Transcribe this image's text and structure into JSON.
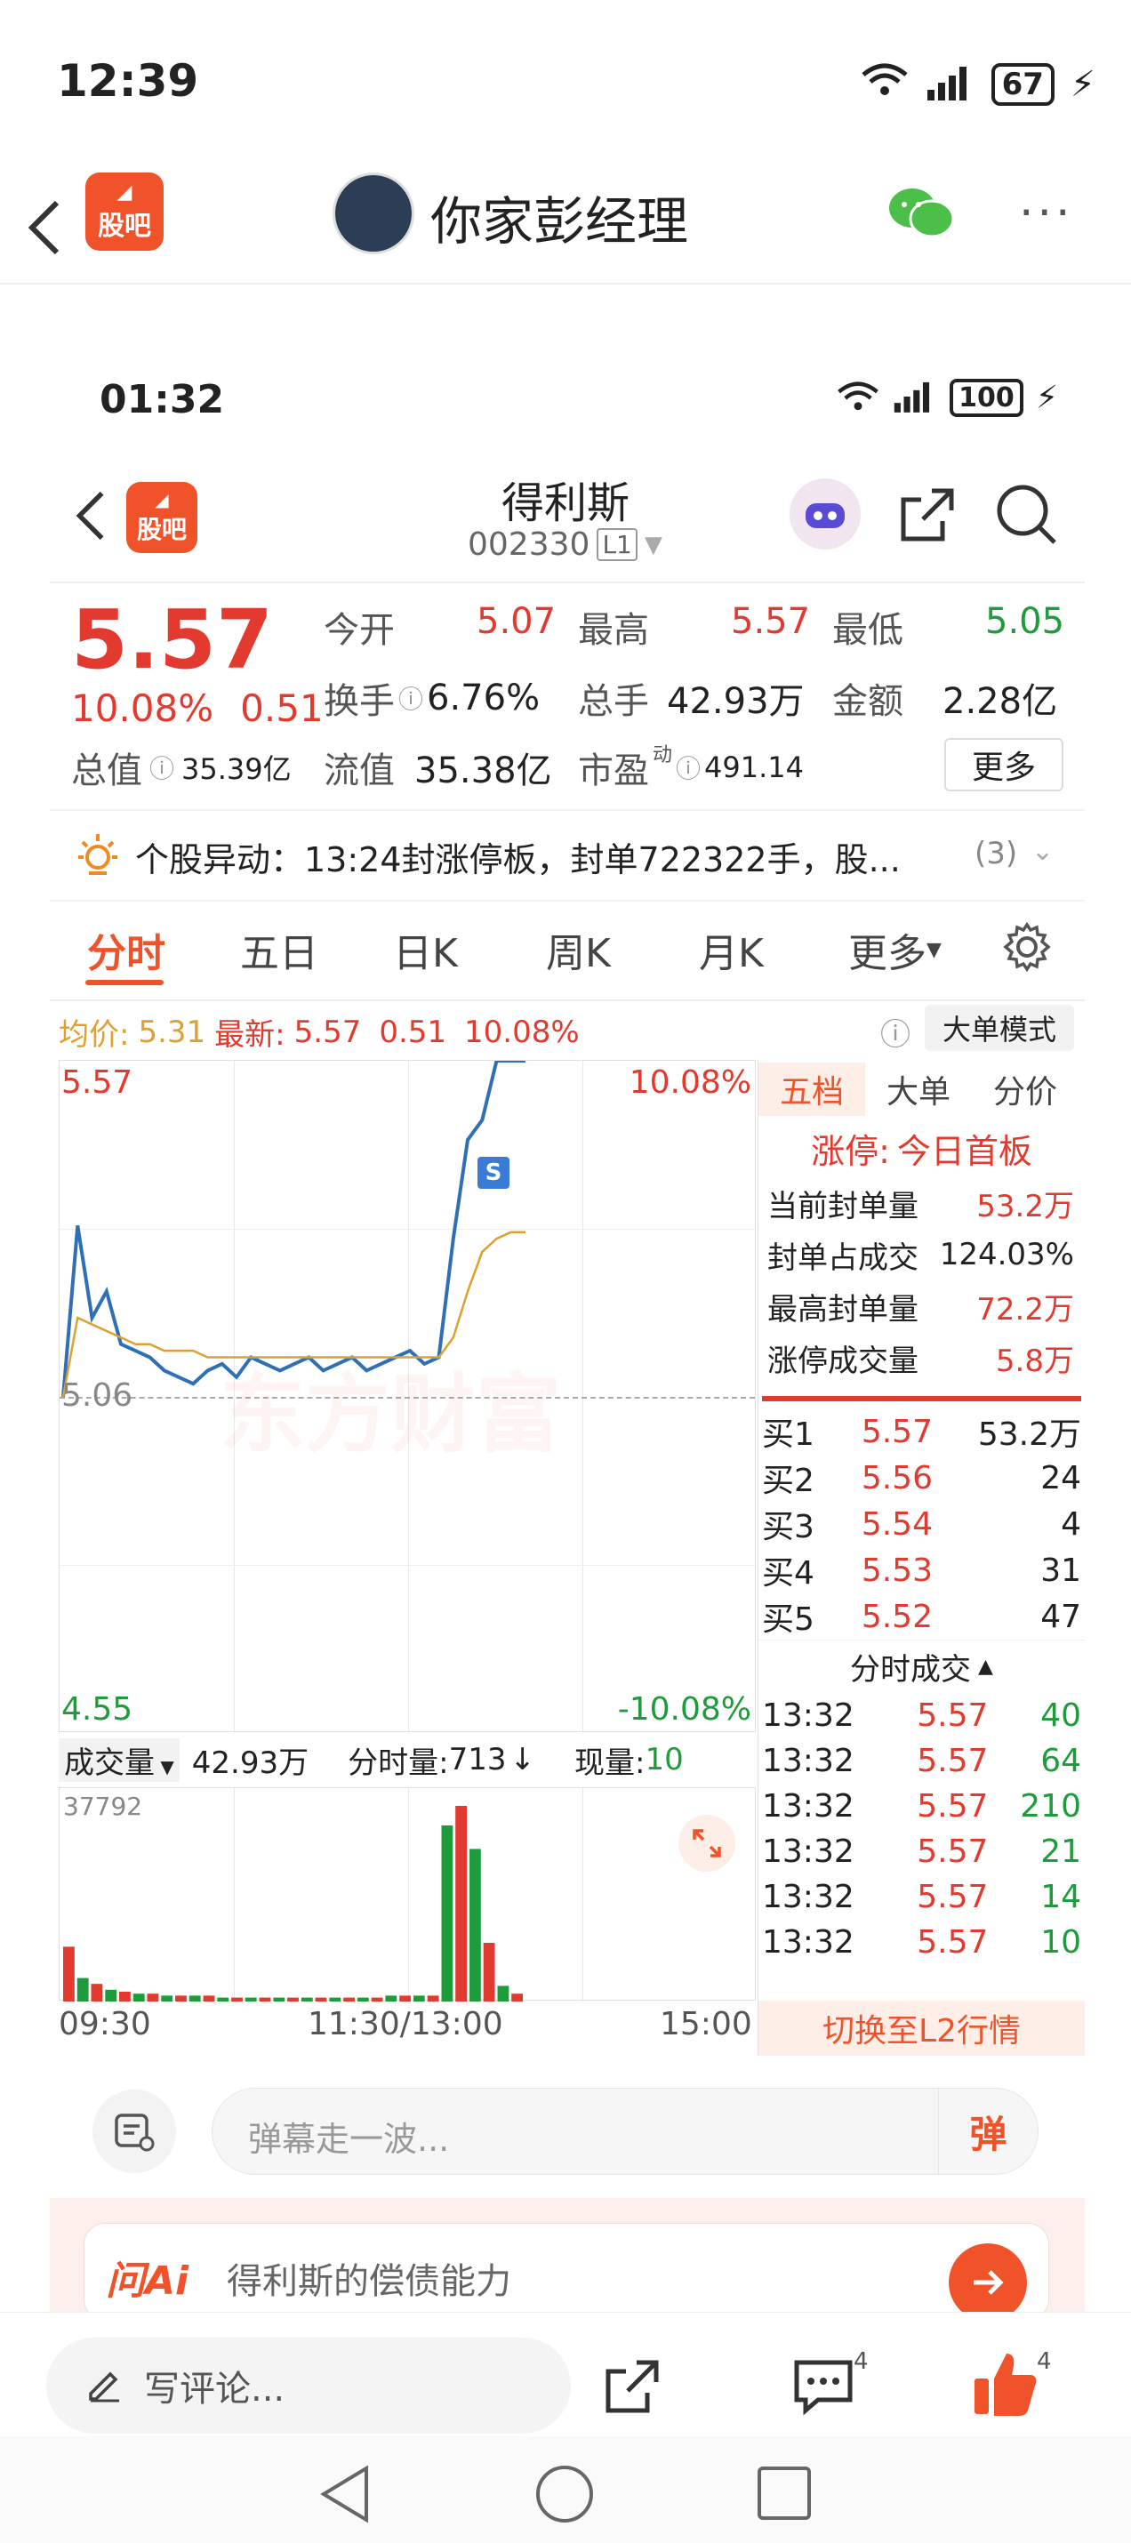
{
  "outer_status": {
    "time": "12:39",
    "battery": "67"
  },
  "outer_nav": {
    "logo": "股吧",
    "title": "你家彭经理"
  },
  "inner_status": {
    "time": "01:32",
    "battery": "100"
  },
  "stock": {
    "name": "得利斯",
    "code": "002330",
    "level": "L1"
  },
  "quote": {
    "price": "5.57",
    "change_pct": "10.08%",
    "change": "0.51",
    "open_label": "今开",
    "open": "5.07",
    "high_label": "最高",
    "high": "5.57",
    "low_label": "最低",
    "low": "5.05",
    "turnover_label": "换手",
    "turnover": "6.76%",
    "volume_label": "总手",
    "volume": "42.93万",
    "amount_label": "金额",
    "amount": "2.28亿",
    "mktcap_label": "总值",
    "mktcap": "35.39亿",
    "float_label": "流值",
    "float": "35.38亿",
    "pe_label": "市盈",
    "pe_sup": "动",
    "pe": "491.14",
    "more_button": "更多"
  },
  "alert": {
    "text": "个股异动：13:24封涨停板，封单722322手，股...",
    "count": "(3)"
  },
  "tabs": [
    "分时",
    "五日",
    "日K",
    "周K",
    "月K",
    "更多"
  ],
  "avg_bar": {
    "avg_label": "均价:",
    "avg": "5.31",
    "latest_label": "最新:",
    "latest": "5.57",
    "change": "0.51",
    "pct": "10.08%",
    "mode_button": "大单模式"
  },
  "chart_labels": {
    "top_price": "5.57",
    "top_pct": "10.08%",
    "mid_price": "5.06",
    "bottom_price": "4.55",
    "bottom_pct": "-10.08%",
    "watermark": "东方财富",
    "s_marker": "S"
  },
  "volume_bar": {
    "label": "成交量",
    "total": "42.93万",
    "minute_label": "分时量:",
    "minute": "713",
    "arrow": "↓",
    "current_label": "现量:",
    "current": "10",
    "max": "37792"
  },
  "time_axis": [
    "09:30",
    "11:30/13:00",
    "15:00"
  ],
  "right_tabs": [
    "五档",
    "大单",
    "分价"
  ],
  "limit_info": {
    "title_label": "涨停:",
    "title_value": "今日首板",
    "rows": [
      {
        "label": "当前封单量",
        "value": "53.2万"
      },
      {
        "label": "封单占成交",
        "value": "124.03%"
      },
      {
        "label": "最高封单量",
        "value": "72.2万"
      },
      {
        "label": "涨停成交量",
        "value": "5.8万"
      }
    ]
  },
  "orderbook": [
    {
      "label": "买1",
      "price": "5.57",
      "vol": "53.2万"
    },
    {
      "label": "买2",
      "price": "5.56",
      "vol": "24"
    },
    {
      "label": "买3",
      "price": "5.54",
      "vol": "4"
    },
    {
      "label": "买4",
      "price": "5.53",
      "vol": "31"
    },
    {
      "label": "买5",
      "price": "5.52",
      "vol": "47"
    }
  ],
  "ticks_title": "分时成交",
  "ticks": [
    {
      "time": "13:32",
      "price": "5.57",
      "vol": "40"
    },
    {
      "time": "13:32",
      "price": "5.57",
      "vol": "64"
    },
    {
      "time": "13:32",
      "price": "5.57",
      "vol": "210"
    },
    {
      "time": "13:32",
      "price": "5.57",
      "vol": "21"
    },
    {
      "time": "13:32",
      "price": "5.57",
      "vol": "14"
    },
    {
      "time": "13:32",
      "price": "5.57",
      "vol": "10"
    }
  ],
  "l2_button": "切换至L2行情",
  "danmu_placeholder": "弹幕走一波...",
  "danmu_button": "弹",
  "ai": {
    "logo": "问Ai",
    "text": "得利斯的偿债能力"
  },
  "bottom": {
    "comment": "写评论...",
    "comment_count": "4",
    "like_count": "4"
  },
  "colors": {
    "up": "#e23a2e",
    "down": "#1e9b3a",
    "accent": "#f0532a",
    "line": "#2f6fb5",
    "avg": "#e0a030"
  },
  "chart_data": {
    "type": "line",
    "x_range": [
      "09:30",
      "15:00"
    ],
    "ylim": [
      4.55,
      5.57
    ],
    "prev_close": 5.06,
    "series": [
      {
        "name": "price",
        "values": [
          5.06,
          5.32,
          5.18,
          5.22,
          5.14,
          5.13,
          5.12,
          5.1,
          5.09,
          5.08,
          5.1,
          5.11,
          5.09,
          5.12,
          5.11,
          5.1,
          5.11,
          5.12,
          5.1,
          5.11,
          5.12,
          5.1,
          5.11,
          5.12,
          5.13,
          5.11,
          5.12,
          5.3,
          5.45,
          5.48,
          5.57,
          5.57,
          5.57
        ]
      },
      {
        "name": "avg",
        "values": [
          5.06,
          5.18,
          5.17,
          5.16,
          5.15,
          5.14,
          5.14,
          5.13,
          5.13,
          5.13,
          5.12,
          5.12,
          5.12,
          5.12,
          5.12,
          5.12,
          5.12,
          5.12,
          5.12,
          5.12,
          5.12,
          5.12,
          5.12,
          5.12,
          5.12,
          5.12,
          5.12,
          5.15,
          5.22,
          5.28,
          5.3,
          5.31,
          5.31
        ]
      }
    ],
    "volume": [
      28,
      12,
      9,
      6,
      5,
      4,
      4,
      3,
      3,
      3,
      3,
      2,
      2,
      2,
      2,
      2,
      2,
      2,
      2,
      2,
      2,
      2,
      2,
      3,
      3,
      3,
      3,
      90,
      100,
      78,
      30,
      8,
      4
    ]
  }
}
